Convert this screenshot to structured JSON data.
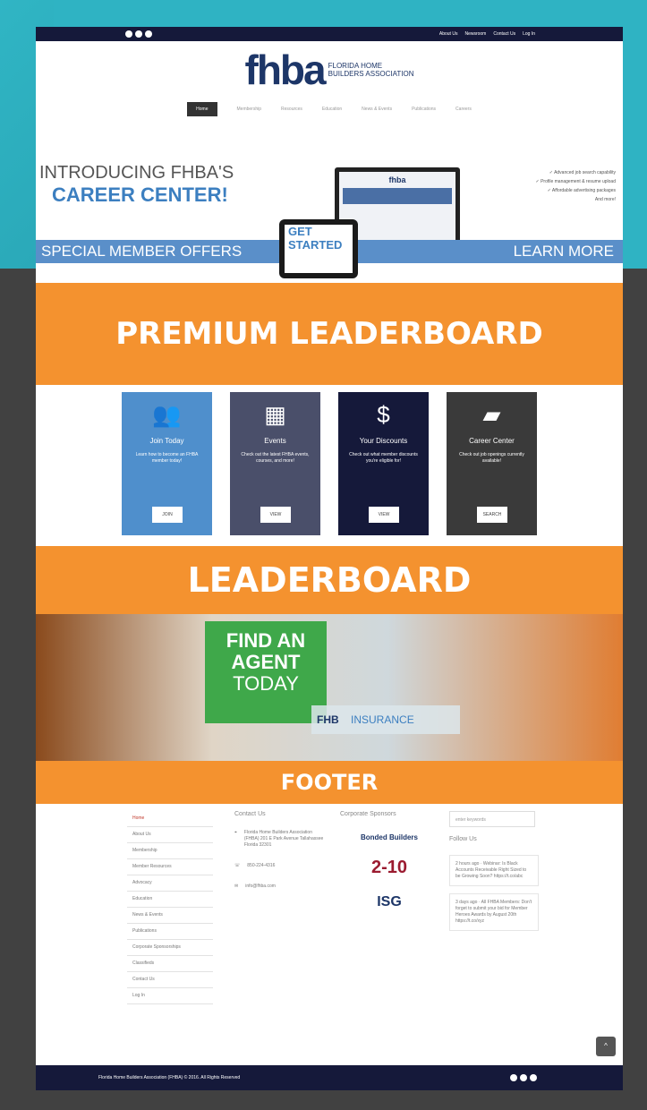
{
  "topbar": {
    "links": [
      "About Us",
      "Newsroom",
      "Contact Us",
      "Log In"
    ]
  },
  "logo": {
    "main": "fhba",
    "sub_line1": "FLORIDA HOME",
    "sub_line2": "BUILDERS ASSOCIATION"
  },
  "nav": [
    "Home",
    "Membership",
    "Resources",
    "Education",
    "News & Events",
    "Publications",
    "Careers"
  ],
  "hero": {
    "line1": "INTRODUCING FHBA'S",
    "line2": "CAREER CENTER!",
    "bullets": [
      "✓ Advanced job search capability",
      "✓ Profile management & resume upload",
      "✓ Affordable advertising packages",
      "And more!"
    ],
    "band_left": "SPECIAL MEMBER OFFERS",
    "band_right": "LEARN MORE",
    "get_started": "GET STARTED",
    "monitor_logo": "fhba"
  },
  "premium_label": "PREMIUM LEADERBOARD",
  "boxes": [
    {
      "title": "Join Today",
      "desc": "Learn how to become an FHBA member today!",
      "button": "JOIN",
      "icon": "users-icon",
      "glyph": "👥",
      "color": "#4f8fcc"
    },
    {
      "title": "Events",
      "desc": "Check out the latest FHBA events, courses, and more!",
      "button": "VIEW",
      "icon": "calendar-icon",
      "glyph": "▦",
      "color": "#4a4f6a"
    },
    {
      "title": "Your Discounts",
      "desc": "Check out what member discounts you're eligible for!",
      "button": "VIEW",
      "icon": "dollar-icon",
      "glyph": "$",
      "color": "#15193a"
    },
    {
      "title": "Career Center",
      "desc": "Check out job openings currently available!",
      "button": "SEARCH",
      "icon": "book-icon",
      "glyph": "▰",
      "color": "#3a3a3a"
    }
  ],
  "leaderboard_label": "LEADERBOARD",
  "agent_ad": {
    "line1": "FIND AN",
    "line2": "AGENT",
    "line3": "TODAY",
    "fhb": "FHB",
    "insurance": "INSURANCE"
  },
  "footer_label": "FOOTER",
  "footer_menu": [
    "Home",
    "About Us",
    "Membership",
    "Member Resources",
    "Advocacy",
    "Education",
    "News & Events",
    "Publications",
    "Corporate Sponsorships",
    "Classifieds",
    "Contact Us",
    "Log In"
  ],
  "contact": {
    "heading": "Contact Us",
    "address": "Florida Home Builders Association (FHBA) 201 E Park Avenue Tallahassee Florida 32301",
    "phone": "850-224-4316",
    "email": "info@fhba.com"
  },
  "sponsors": {
    "heading": "Corporate Sponsors",
    "s1": "Bonded Builders",
    "s2": "2-10",
    "s3": "ISG"
  },
  "search": {
    "placeholder": "enter keywords"
  },
  "follow": {
    "heading": "Follow Us",
    "tweet1": "2 hours ago · Webinar: Is Black Accounts Receivable Right Sized to be Growing Soon? https://t.co/abc",
    "tweet2": "3 days ago · All FHBA Members: Don't forget to submit your bid for Member Heroes Awards by August 20th https://t.co/xyz"
  },
  "bottombar": {
    "copyright": "Florida Home Builders Association (FHBA) © 2016. All Rights Reserved"
  }
}
